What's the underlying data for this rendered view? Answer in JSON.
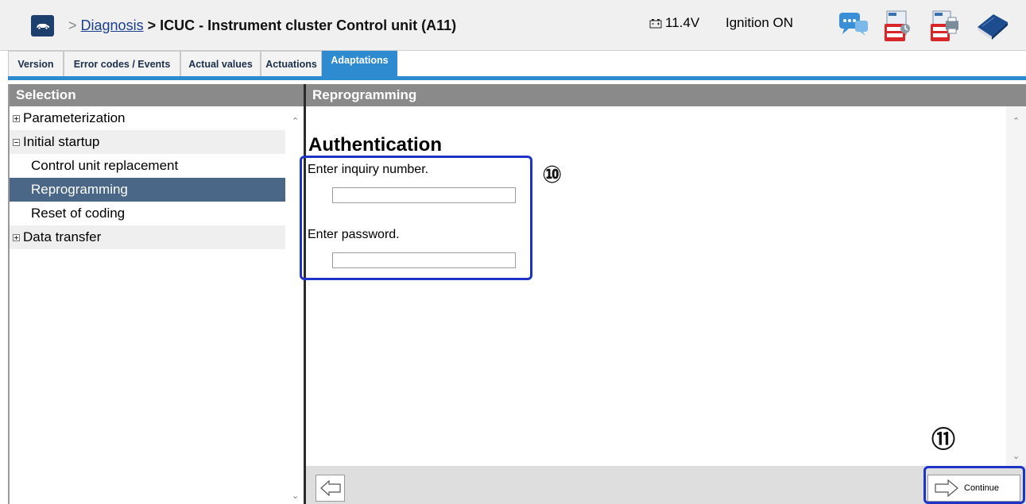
{
  "header": {
    "breadcrumb_sep1": ">",
    "breadcrumb_link": "Diagnosis",
    "breadcrumb_current": "> ICUC - Instrument cluster Control unit (A11)",
    "voltage": "11.4V",
    "ignition": "Ignition ON",
    "icons": [
      "car-icon",
      "chat-icon",
      "pdf-export-icon",
      "pdf-print-icon",
      "manual-book-icon"
    ]
  },
  "tabs": [
    {
      "label": "Version",
      "active": false
    },
    {
      "label": "Error codes / Events",
      "active": false
    },
    {
      "label": "Actual values",
      "active": false
    },
    {
      "label": "Actuations",
      "active": false
    },
    {
      "label": "Adaptations",
      "active": true
    }
  ],
  "selection": {
    "title": "Selection",
    "items": [
      {
        "label": "Parameterization",
        "type": "group",
        "expanded": false
      },
      {
        "label": "Initial startup",
        "type": "group",
        "expanded": true
      },
      {
        "label": "Control unit replacement",
        "type": "child",
        "selected": false
      },
      {
        "label": "Reprogramming",
        "type": "child",
        "selected": true
      },
      {
        "label": "Reset of coding",
        "type": "child",
        "selected": false
      },
      {
        "label": "Data transfer",
        "type": "group",
        "expanded": false
      }
    ]
  },
  "content": {
    "title": "Reprogramming",
    "heading": "Authentication",
    "inquiry_label": "Enter inquiry number.",
    "inquiry_value": "",
    "password_label": "Enter password.",
    "password_value": ""
  },
  "footer": {
    "continue_label": "Continue"
  },
  "annotations": {
    "step10": "⑩",
    "step11": "⑪",
    "color": "#1f33c7"
  },
  "colors": {
    "tab_accent": "#2e8bd0",
    "panel_header": "#8a8a8a",
    "selected_row": "#4b6787"
  }
}
